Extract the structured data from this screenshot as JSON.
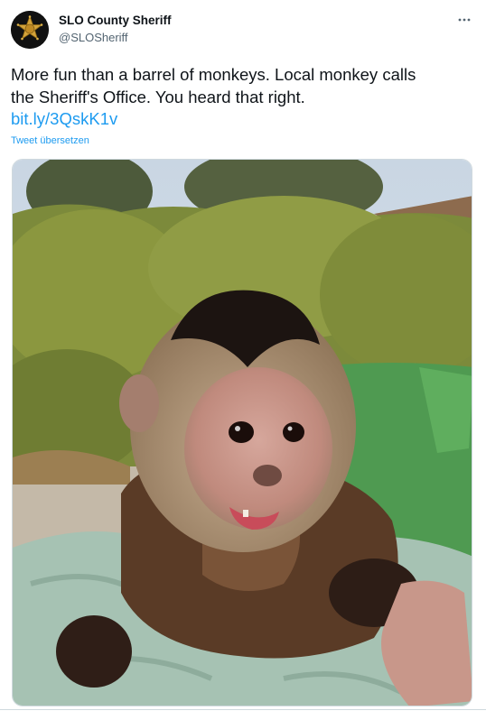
{
  "account": {
    "name": "SLO County Sheriff",
    "handle": "@SLOSheriff",
    "avatar_icon": "sheriff-star-badge-icon"
  },
  "tweet": {
    "text_lines": [
      "More fun than a barrel of monkeys. Local monkey calls",
      "the Sheriff's Office. You heard that right."
    ],
    "link": "bit.ly/3QskK1v",
    "translate_label": "Tweet übersetzen"
  },
  "menu": {
    "icon": "more-options-icon"
  },
  "media": {
    "description_icon": "capuchin-monkey-photo"
  },
  "colors": {
    "link": "#1d9bf0",
    "text": "#0f1419",
    "muted": "#536471"
  }
}
